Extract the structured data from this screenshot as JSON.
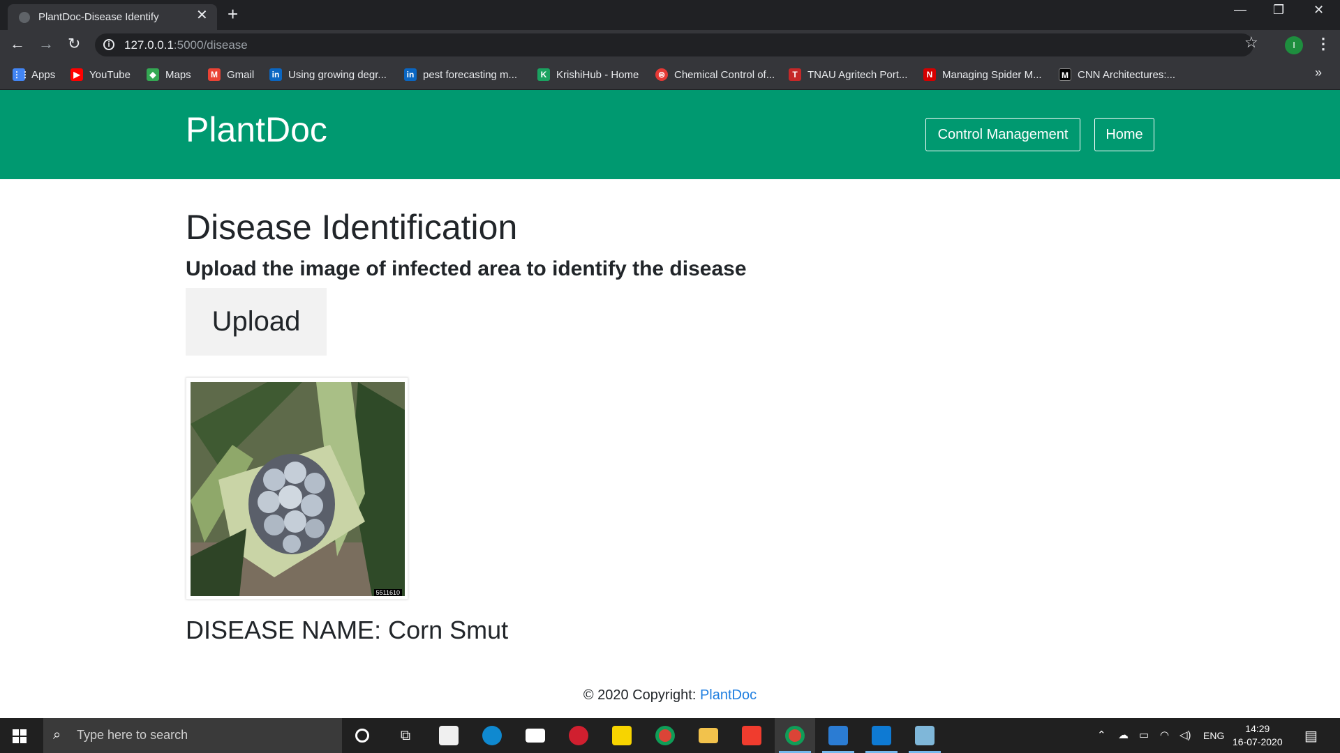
{
  "browser": {
    "tab_title": "PlantDoc-Disease Identify",
    "tab_close": "✕",
    "new_tab": "+",
    "minimize": "—",
    "restore": "❐",
    "close": "✕",
    "url_host": "127.0.0.1",
    "url_path": ":5000/disease",
    "profile_initial": "I",
    "bookmarks": [
      {
        "label": "Apps",
        "icon": "apps-grid-icon",
        "color": "#4285f4"
      },
      {
        "label": "YouTube",
        "icon": "youtube-icon",
        "color": "#ff0000"
      },
      {
        "label": "Maps",
        "icon": "maps-icon",
        "color": "#34a853"
      },
      {
        "label": "Gmail",
        "icon": "gmail-icon",
        "color": "#ea4335"
      },
      {
        "label": "Using growing degr...",
        "icon": "linkedin-icon",
        "color": "#0a66c2"
      },
      {
        "label": "pest forecasting m...",
        "icon": "linkedin-icon",
        "color": "#0a66c2"
      },
      {
        "label": "KrishiHub - Home",
        "icon": "krishihub-icon",
        "color": "#1aa260"
      },
      {
        "label": "Chemical Control of...",
        "icon": "chemical-icon",
        "color": "#e53935"
      },
      {
        "label": "TNAU Agritech Port...",
        "icon": "tnau-icon",
        "color": "#c62828"
      },
      {
        "label": "Managing Spider M...",
        "icon": "managing-icon",
        "color": "#d50000"
      },
      {
        "label": "CNN Architectures:...",
        "icon": "medium-icon",
        "color": "#000000"
      }
    ],
    "bookmarks_more": "»"
  },
  "navbar": {
    "brand": "PlantDoc",
    "control_management": "Control Management",
    "home": "Home",
    "bg_color": "#009970"
  },
  "main": {
    "title": "Disease Identification",
    "subtitle": "Upload the image of infected area to identify the disease",
    "upload_label": "Upload",
    "image_caption": "5511610",
    "disease_name": "DISEASE NAME: Corn Smut"
  },
  "footer": {
    "copyright": "© 2020 Copyright: ",
    "link": "PlantDoc"
  },
  "taskbar": {
    "search_placeholder": "Type here to search",
    "language": "ENG",
    "time": "14:29",
    "date": "16-07-2020"
  }
}
